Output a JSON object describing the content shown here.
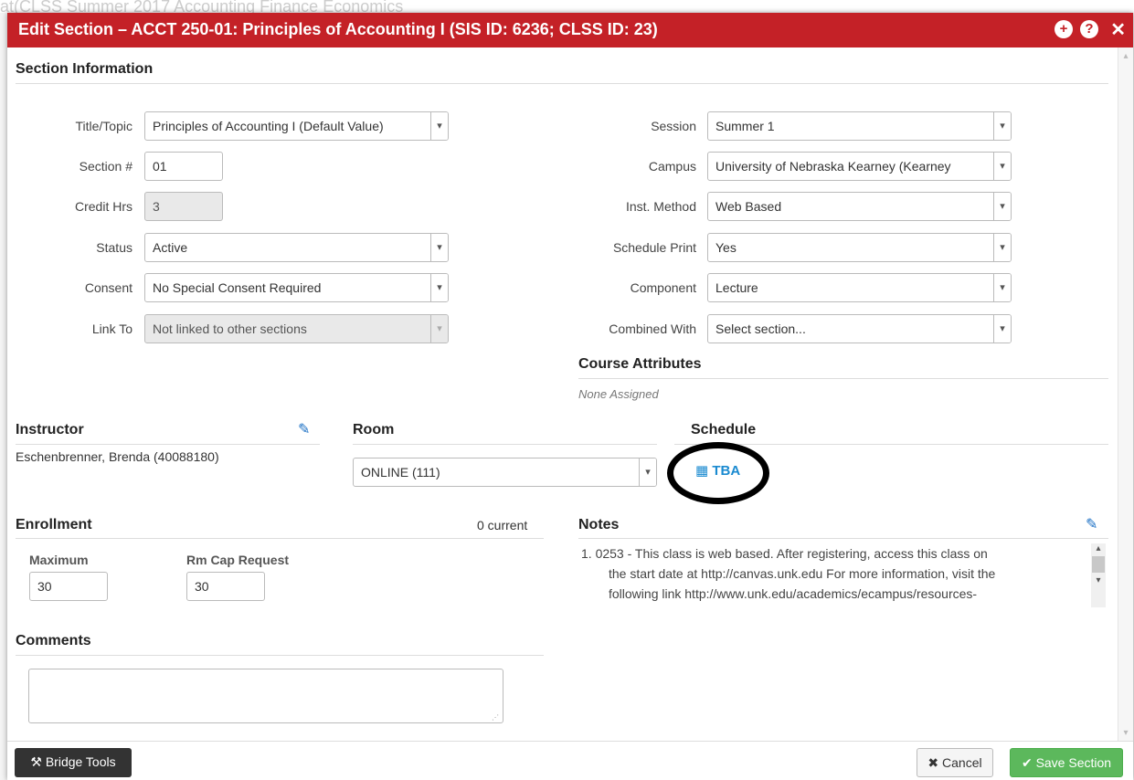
{
  "background": {
    "text": "at(CLSS  Summer 2017  Accounting Finance Economics"
  },
  "dialog": {
    "title": "Edit Section – ACCT 250-01: Principles of Accounting I (SIS ID: 6236; CLSS ID: 23)",
    "icons": [
      "plus-circle-icon",
      "question-circle-icon",
      "close-icon"
    ]
  },
  "section_info": {
    "heading": "Section Information",
    "left": [
      {
        "label": "Title/Topic",
        "value": "Principles of Accounting I (Default Value)",
        "type": "select"
      },
      {
        "label": "Section #",
        "value": "01",
        "type": "input"
      },
      {
        "label": "Credit Hrs",
        "value": "3",
        "type": "disabled-input"
      },
      {
        "label": "Status",
        "value": "Active",
        "type": "select"
      },
      {
        "label": "Consent",
        "value": "No Special Consent Required",
        "type": "select"
      },
      {
        "label": "Link To",
        "value": "Not linked to other sections",
        "type": "disabled-select"
      }
    ],
    "right": [
      {
        "label": "Session",
        "value": "Summer 1",
        "type": "select"
      },
      {
        "label": "Campus",
        "value": "University of Nebraska Kearney (Kearney",
        "type": "select"
      },
      {
        "label": "Inst. Method",
        "value": "Web Based",
        "type": "select"
      },
      {
        "label": "Schedule Print",
        "value": "Yes",
        "type": "select"
      },
      {
        "label": "Component",
        "value": "Lecture",
        "type": "select"
      },
      {
        "label": "Combined With",
        "value": "Select section...",
        "type": "select"
      }
    ]
  },
  "course_attributes": {
    "heading": "Course Attributes",
    "value": "None Assigned"
  },
  "instructor": {
    "heading": "Instructor",
    "value": "Eschenbrenner, Brenda (40088180)"
  },
  "room": {
    "heading": "Room",
    "value": "ONLINE (111)"
  },
  "schedule": {
    "heading": "Schedule",
    "value": "TBA"
  },
  "enrollment": {
    "heading": "Enrollment",
    "current": "0 current",
    "maximum_label": "Maximum",
    "maximum_value": "30",
    "rmcap_label": "Rm Cap Request",
    "rmcap_value": "30"
  },
  "notes": {
    "heading": "Notes",
    "lines": [
      "1. 0253 - This class is web based. After registering, access this class on",
      "the start date at http://canvas.unk.edu For more information, visit the",
      "following link http://www.unk.edu/academics/ecampus/resources-"
    ]
  },
  "comments": {
    "heading": "Comments",
    "value": ""
  },
  "footer": {
    "bridge_tools": "Bridge Tools",
    "cancel": "Cancel",
    "save": "Save Section"
  }
}
